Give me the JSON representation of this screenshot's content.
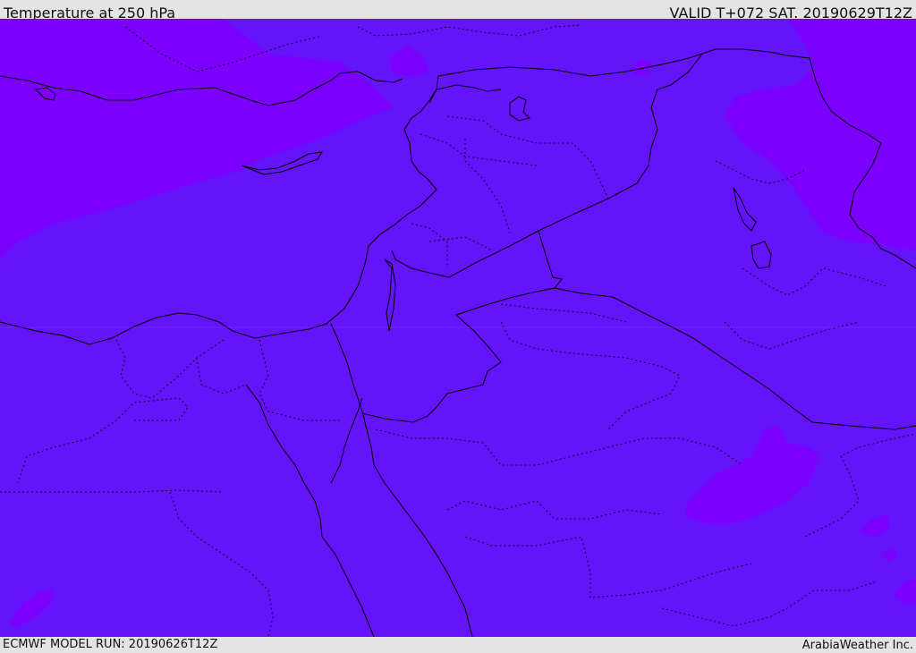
{
  "header": {
    "title": "Temperature at 250 hPa",
    "valid": "VALID T+072 SAT. 20190629T12Z"
  },
  "footer": {
    "model_run": "ECMWF MODEL RUN: 20190626T12Z",
    "provider": "ArabiaWeather Inc."
  },
  "map": {
    "colors": {
      "field_main": "#6414fa",
      "field_cold": "#7b00fe",
      "border": "#000000"
    },
    "icons": [
      "country-border-lines",
      "province-border-dotted-lines",
      "coastline"
    ]
  }
}
